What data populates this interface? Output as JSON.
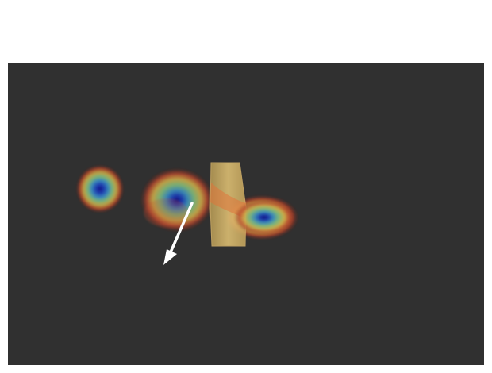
{
  "scene": {
    "background_color": "#303030",
    "heatmap_palette": [
      "#1a1aa0",
      "#2f7fc0",
      "#7fc07f",
      "#d8b040",
      "#c03020"
    ],
    "object_color": "#e8c070",
    "arrow_color": "#ffffff",
    "icons": {
      "arrow": "direction-arrow-icon"
    }
  }
}
